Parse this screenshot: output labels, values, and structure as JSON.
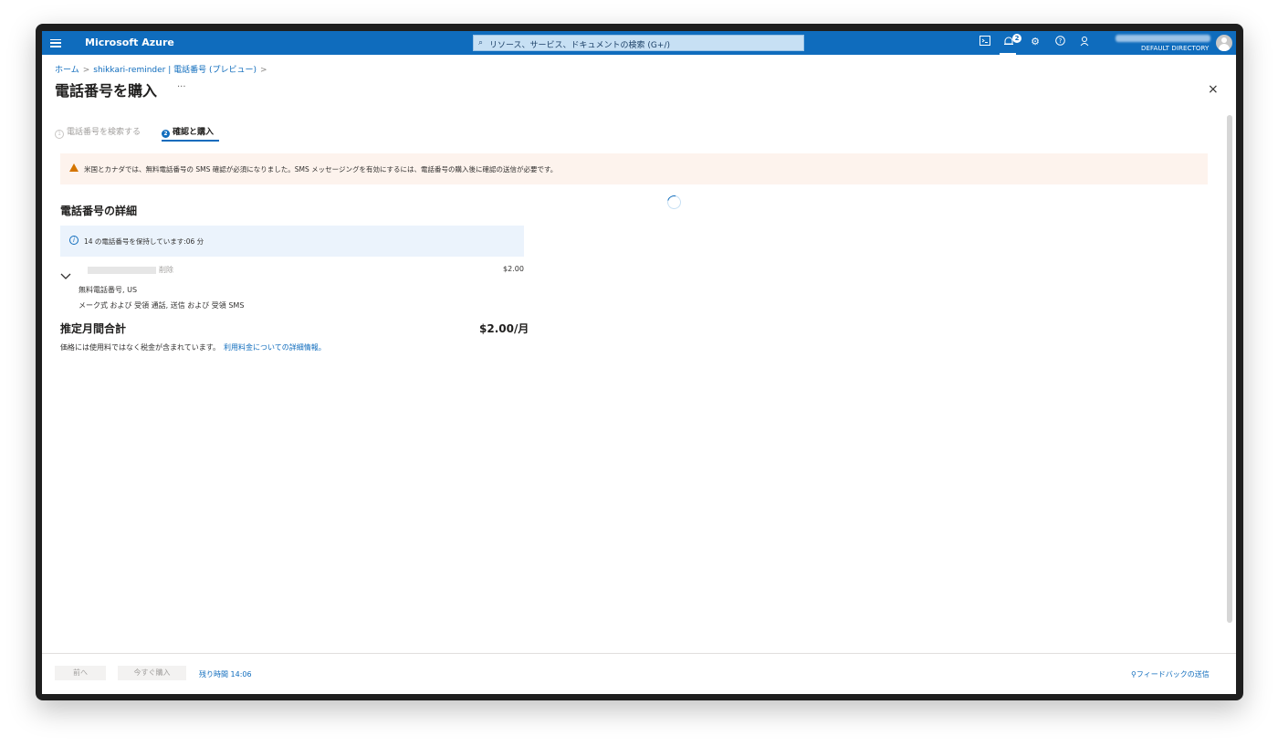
{
  "topbar": {
    "brand": "Microsoft Azure",
    "search_placeholder": "リソース、サービス、ドキュメントの検索 (G+/)",
    "notification_count": "2",
    "directory": "DEFAULT DIRECTORY",
    "icons": [
      "cloud-shell-icon",
      "notification-icon",
      "settings-icon",
      "help-icon",
      "feedback-icon"
    ]
  },
  "breadcrumb": {
    "home": "ホーム",
    "resource": "shikkari-reminder | 電話番号 (プレビュー)"
  },
  "page": {
    "title": "電話番号を購入",
    "more": "···",
    "close": "×"
  },
  "tabs": [
    {
      "step": "1",
      "label": "電話番号を検索する",
      "active": false
    },
    {
      "step": "2",
      "label": "確認と購入",
      "active": true
    }
  ],
  "warning": {
    "text": "米国とカナダでは、無料電話番号の SMS 確認が必須になりました。SMS メッセージングを有効にするには、電話番号の購入後に確認の送信が必要です。"
  },
  "details": {
    "heading": "電話番号の詳細",
    "info_text": "14 の電話番号を保持しています:06 分",
    "item": {
      "delete_label": "削除",
      "price": "$2.00",
      "type_line": "無料電話番号, US",
      "capabilities_line": "メーク式 および 受領 通話, 送信 および 受領 SMS"
    },
    "total_label": "推定月間合計",
    "total_value": "$2.00/月",
    "tax_note": "価格には使用料ではなく税金が含まれています。",
    "tax_link": "利用料金についての詳細情報。"
  },
  "footer": {
    "prev_label": "前へ",
    "buy_label": "今すぐ購入",
    "timer": "残り時間 14:06",
    "feedback": "フィードバックの送信"
  },
  "colors": {
    "accent": "#0f6cbd",
    "warning_bg": "#fdf3ed",
    "info_bg": "#ebf3fc"
  }
}
